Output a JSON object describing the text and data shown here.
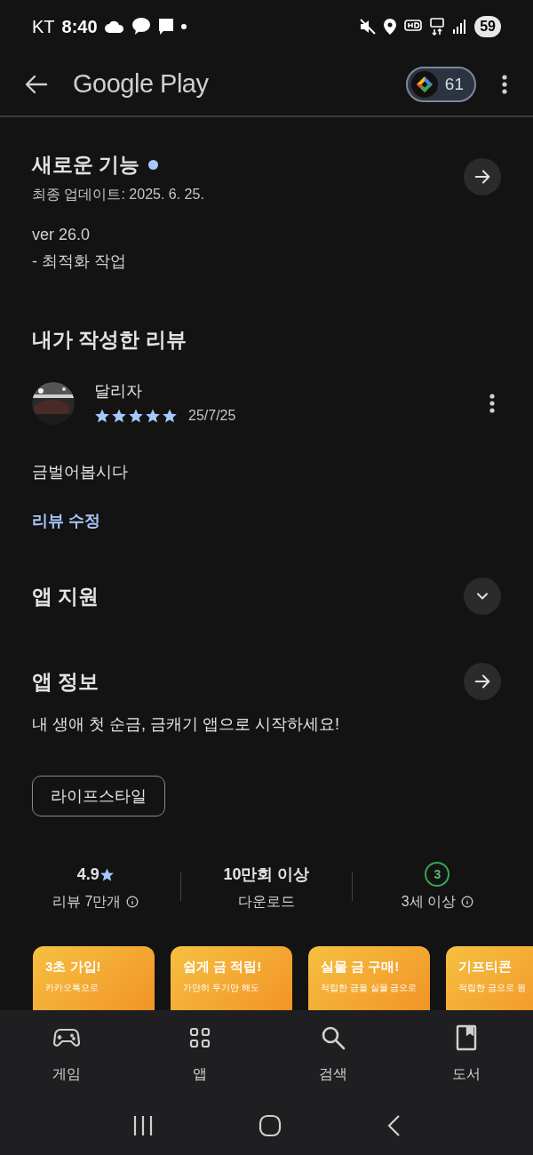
{
  "status_bar": {
    "carrier": "KT",
    "time": "8:40",
    "battery": "59"
  },
  "app_bar": {
    "title": "Google Play",
    "points": "61"
  },
  "whats_new": {
    "title": "새로운 기능",
    "updated": "최종 업데이트: 2025. 6. 25.",
    "notes": [
      "ver 26.0",
      "- 최적화 작업"
    ]
  },
  "my_review": {
    "heading": "내가 작성한 리뷰",
    "author": "달리자",
    "stars": 5,
    "date": "25/7/25",
    "text": "금벌어봅시다",
    "edit_link": "리뷰 수정"
  },
  "sections": [
    {
      "title": "앱 지원",
      "kind": "expand"
    },
    {
      "title": "앱 정보",
      "kind": "arrow"
    }
  ],
  "description": "내 생애 첫 순금, 금캐기 앱으로 시작하세요!",
  "category_chip": "라이프스타일",
  "stats": [
    {
      "kind": "rating",
      "value": "4.9",
      "label": "리뷰 7만개",
      "info": true
    },
    {
      "kind": "text",
      "value": "10만회 이상",
      "label": "다운로드",
      "info": false
    },
    {
      "kind": "age",
      "value": "3",
      "label": "3세 이상",
      "info": true
    }
  ],
  "screenshots": [
    {
      "title": "3초 가입!",
      "caption": "카카오톡으로"
    },
    {
      "title": "쉽게 금 적립!",
      "caption": "가만히 두기만 해도"
    },
    {
      "title": "실물 금 구매!",
      "caption": "적립한 금을 실물 금으로"
    },
    {
      "title": "기프티콘",
      "caption": "적립한 금으로 원"
    }
  ],
  "bottom_nav": [
    {
      "kind": "games",
      "label": "게임"
    },
    {
      "kind": "apps",
      "label": "앱"
    },
    {
      "kind": "search",
      "label": "검색"
    },
    {
      "kind": "books",
      "label": "도서"
    }
  ]
}
